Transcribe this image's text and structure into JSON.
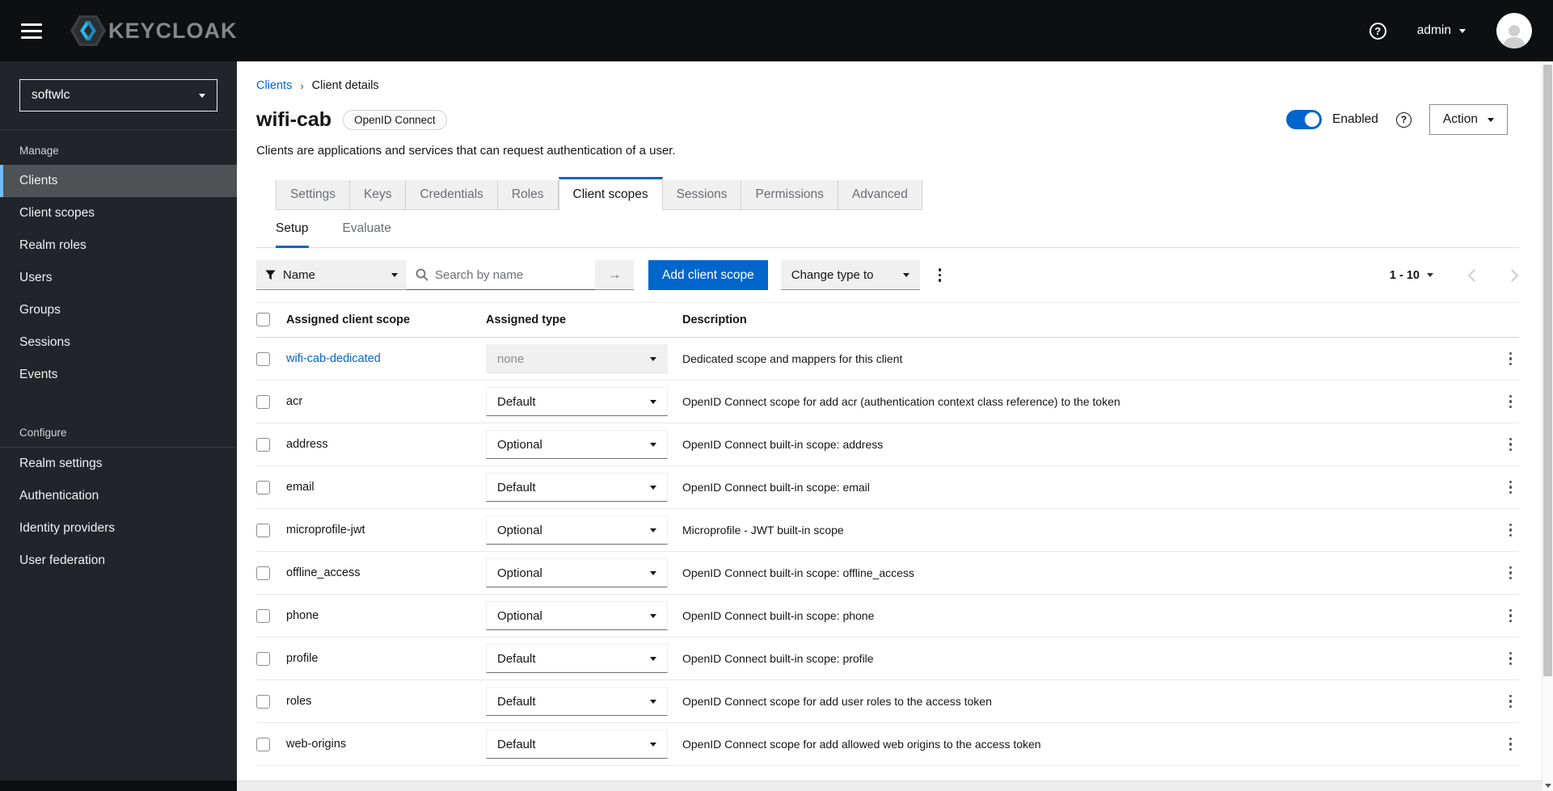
{
  "colors": {
    "primary": "#0066cc",
    "link": "#0066cc",
    "masthead_bg": "#0e0f11",
    "sidebar_bg": "#212529",
    "selected_accent": "#73bcf7",
    "logo_cyan": "#2cb8e5",
    "logo_blue": "#1a8ab8"
  },
  "masthead": {
    "brand": "KEYCLOAK",
    "username": "admin",
    "help_glyph": "?"
  },
  "sidebar": {
    "realm": "softwlc",
    "sections": [
      {
        "label": "Manage",
        "items": [
          {
            "label": "Clients",
            "selected": true
          },
          {
            "label": "Client scopes"
          },
          {
            "label": "Realm roles"
          },
          {
            "label": "Users"
          },
          {
            "label": "Groups"
          },
          {
            "label": "Sessions"
          },
          {
            "label": "Events"
          }
        ]
      },
      {
        "label": "Configure",
        "divider": true,
        "items": [
          {
            "label": "Realm settings"
          },
          {
            "label": "Authentication"
          },
          {
            "label": "Identity providers"
          },
          {
            "label": "User federation"
          }
        ]
      }
    ]
  },
  "breadcrumb": {
    "parent": "Clients",
    "separator": "›",
    "current": "Client details"
  },
  "header": {
    "title": "wifi-cab",
    "badge": "OpenID Connect",
    "subtitle": "Clients are applications and services that can request authentication of a user.",
    "enabled": true,
    "enabled_label": "Enabled",
    "help_glyph": "?",
    "action_label": "Action"
  },
  "tabs": {
    "active": "Client scopes",
    "items": [
      "Settings",
      "Keys",
      "Credentials",
      "Roles",
      "Client scopes",
      "Sessions",
      "Permissions",
      "Advanced"
    ]
  },
  "subtabs": {
    "active": "Setup",
    "items": [
      "Setup",
      "Evaluate"
    ]
  },
  "toolbar": {
    "filter_label": "Name",
    "search_placeholder": "Search by name",
    "search_submit_glyph": "→",
    "add_button_label": "Add client scope",
    "change_type_label": "Change type to",
    "pagination_range": "1 - 10"
  },
  "table": {
    "columns": [
      "Assigned client scope",
      "Assigned type",
      "Description"
    ],
    "rows": [
      {
        "name": "wifi-cab-dedicated",
        "link": true,
        "type": "none",
        "type_disabled": true,
        "description": "Dedicated scope and mappers for this client"
      },
      {
        "name": "acr",
        "link": false,
        "type": "Default",
        "type_disabled": false,
        "description": "OpenID Connect scope for add acr (authentication context class reference) to the token"
      },
      {
        "name": "address",
        "link": false,
        "type": "Optional",
        "type_disabled": false,
        "description": "OpenID Connect built-in scope: address"
      },
      {
        "name": "email",
        "link": false,
        "type": "Default",
        "type_disabled": false,
        "description": "OpenID Connect built-in scope: email"
      },
      {
        "name": "microprofile-jwt",
        "link": false,
        "type": "Optional",
        "type_disabled": false,
        "description": "Microprofile - JWT built-in scope"
      },
      {
        "name": "offline_access",
        "link": false,
        "type": "Optional",
        "type_disabled": false,
        "description": "OpenID Connect built-in scope: offline_access"
      },
      {
        "name": "phone",
        "link": false,
        "type": "Optional",
        "type_disabled": false,
        "description": "OpenID Connect built-in scope: phone"
      },
      {
        "name": "profile",
        "link": false,
        "type": "Default",
        "type_disabled": false,
        "description": "OpenID Connect built-in scope: profile"
      },
      {
        "name": "roles",
        "link": false,
        "type": "Default",
        "type_disabled": false,
        "description": "OpenID Connect scope for add user roles to the access token"
      },
      {
        "name": "web-origins",
        "link": false,
        "type": "Default",
        "type_disabled": false,
        "description": "OpenID Connect scope for add allowed web origins to the access token"
      }
    ]
  },
  "icons": {
    "hamburger": "☰",
    "kebab": "⋮",
    "caret_down": "▾",
    "chevron_left": "‹",
    "chevron_right": "›",
    "search": "magnifier",
    "filter": "funnel",
    "help": "?-circle",
    "user": "person-silhouette"
  }
}
